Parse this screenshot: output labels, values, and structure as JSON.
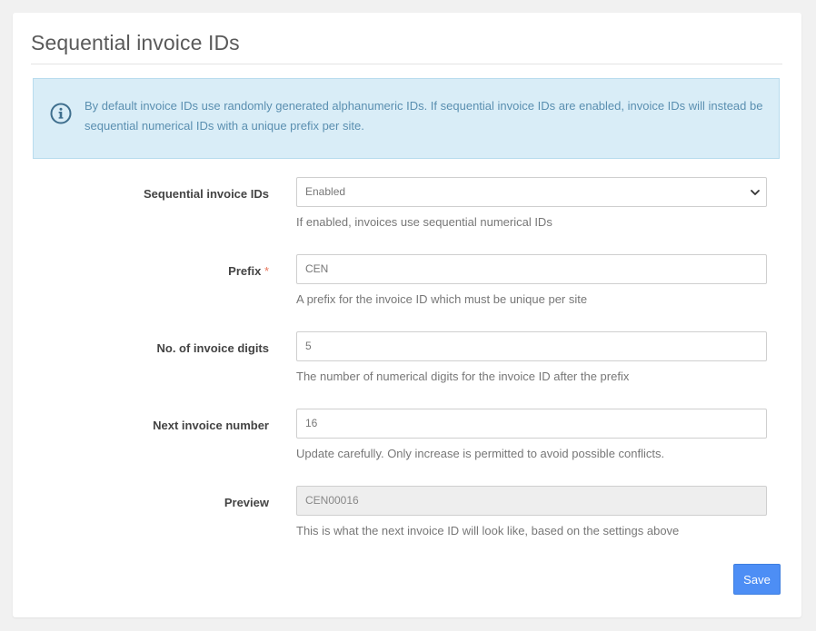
{
  "page": {
    "title": "Sequential invoice IDs"
  },
  "info": {
    "icon": "info-circle-icon",
    "text": "By default invoice IDs use randomly generated alphanumeric IDs. If sequential invoice IDs are enabled, invoice IDs will instead be sequential numerical IDs with a unique prefix per site."
  },
  "fields": {
    "sequential": {
      "label": "Sequential invoice IDs",
      "value": "Enabled",
      "help": "If enabled, invoices use sequential numerical IDs"
    },
    "prefix": {
      "label": "Prefix",
      "required_marker": "*",
      "value": "CEN",
      "help": "A prefix for the invoice ID which must be unique per site"
    },
    "digits": {
      "label": "No. of invoice digits",
      "value": "5",
      "help": "The number of numerical digits for the invoice ID after the prefix"
    },
    "next_number": {
      "label": "Next invoice number",
      "value": "16",
      "help": "Update carefully. Only increase is permitted to avoid possible conflicts."
    },
    "preview": {
      "label": "Preview",
      "value": "CEN00016",
      "help": "This is what the next invoice ID will look like, based on the settings above"
    }
  },
  "actions": {
    "save_label": "Save"
  },
  "colors": {
    "accent": "#4d8ef5",
    "info_bg": "#d9edf7",
    "info_text": "#5a8fb0",
    "required": "#e8765c"
  }
}
